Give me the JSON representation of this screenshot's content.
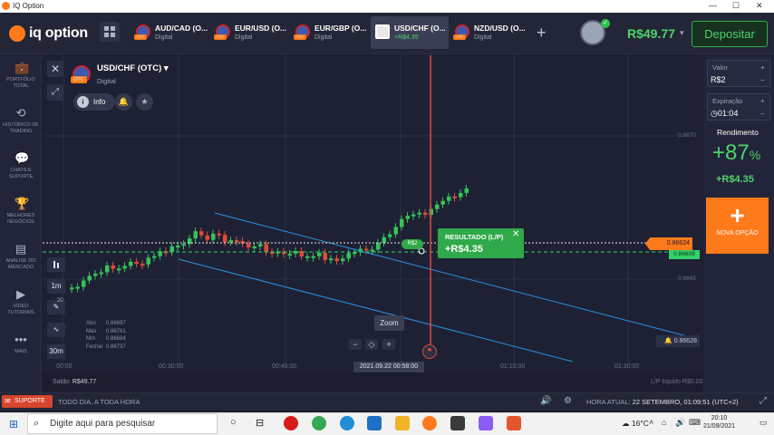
{
  "window": {
    "title": "IQ Option",
    "minimize": "—",
    "maximize": "☐",
    "close": "✕"
  },
  "header": {
    "brand": "iq option",
    "tabs": [
      {
        "name": "AUD/CAD (O...",
        "sub": "Digital",
        "close": "✕"
      },
      {
        "name": "EUR/USD (O...",
        "sub": "Digital",
        "close": "✕"
      },
      {
        "name": "EUR/GBP (O...",
        "sub": "Digital",
        "close": "✕"
      },
      {
        "name": "USD/CHF (O...",
        "sub": "+R$4.35",
        "close": "✕"
      },
      {
        "name": "NZD/USD (O...",
        "sub": "Digital",
        "close": "✕"
      }
    ],
    "add_tab": "+",
    "balance": "R$49.77",
    "balance_caret": "▾",
    "avatar_check": "✓",
    "deposit": "Depositar"
  },
  "sidebar": {
    "items": [
      {
        "icon": "briefcase-icon",
        "glyph": "💼",
        "label": "PORTFÓLIO TOTAL"
      },
      {
        "icon": "history-icon",
        "glyph": "⟲",
        "label": "HISTÓRICO DE TRADING"
      },
      {
        "icon": "chat-icon",
        "glyph": "💬",
        "label": "CHATS E SUPORTE"
      },
      {
        "icon": "trophy-icon",
        "glyph": "🏆",
        "label": "MELHORES NEGÓCIOS"
      },
      {
        "icon": "analysis-icon",
        "glyph": "▤",
        "label": "ANÁLISE DO MERCADO"
      },
      {
        "icon": "video-icon",
        "glyph": "▶",
        "label": "VÍDEO TUTORIAIS"
      },
      {
        "icon": "more-icon",
        "glyph": "•••",
        "label": "MAIS"
      }
    ]
  },
  "chart_panel": {
    "close": "✕",
    "expand": "⤢",
    "asset_otc": "OTC",
    "asset": "USD/CHF (OTC)",
    "asset_caret": "▾",
    "asset_type": "Digital",
    "info": "Info",
    "info_i": "i",
    "bell": "🔔",
    "star": "★",
    "timeframe": "1m",
    "period": "30m",
    "indicator_count": "20",
    "ohlc": {
      "labels": [
        "Abri",
        "Máx",
        "Mín",
        "Fechar"
      ],
      "values": [
        "0.86697",
        "0.86761",
        "0.86684",
        "0.86737"
      ]
    },
    "zoom_label": "Zoom",
    "zoom_minus": "−",
    "zoom_center": "◇",
    "zoom_plus": "+",
    "time_marker": "2021.09.22 00:58:00",
    "x_ticks": [
      "00:00",
      "00:30:00",
      "00:45:00",
      "01:15:00",
      "01:30:00"
    ],
    "y_ticks": [
      "0.8670",
      "0.8665"
    ],
    "price_tag": "0.86624",
    "green_tag": "0.86609",
    "alarm_tag": "0.86628",
    "alarm_icon": "🔔",
    "bet_badge": "R$2",
    "result": {
      "title": "RESULTADO (L/P)",
      "value": "+R$4.35",
      "close": "✕"
    },
    "saldo_label": "Saldo:",
    "saldo_value": "R$49.77",
    "pl_label": "L/P líquido R$0.00"
  },
  "chart_data": {
    "type": "candlestick",
    "series": [
      {
        "name": "USD/CHF (OTC)"
      }
    ],
    "y_ticks": [
      0.867,
      0.8665
    ],
    "current_price": 0.86624,
    "trend_channel": true
  },
  "right_panel": {
    "value_label": "Valor",
    "value": "R$2",
    "plus": "+",
    "minus": "−",
    "expiry_label": "Expiração",
    "expiry": "01:04",
    "return_label": "Rendimento",
    "return_pct": "+87",
    "return_pct_sign": "%",
    "return_value": "+R$4.35",
    "new_option_plus": "+",
    "new_option": "NOVA OPÇÃO"
  },
  "bottom": {
    "support": "SUPORTE",
    "schedule": "TODO DIA, A TODA HORA",
    "server_time_label": "HORA ATUAL:",
    "server_time": "22 SETEMBRO, 01:09:51 (UTC+2)"
  },
  "taskbar": {
    "search_placeholder": "Digite aqui para pesquisar",
    "weather": "16°C",
    "time": "20:10",
    "date": "21/09/2021"
  },
  "colors": {
    "accent": "#ff7a1a",
    "profit": "#4fd26a",
    "loss": "#e24a3a",
    "bg": "#1e2133"
  }
}
